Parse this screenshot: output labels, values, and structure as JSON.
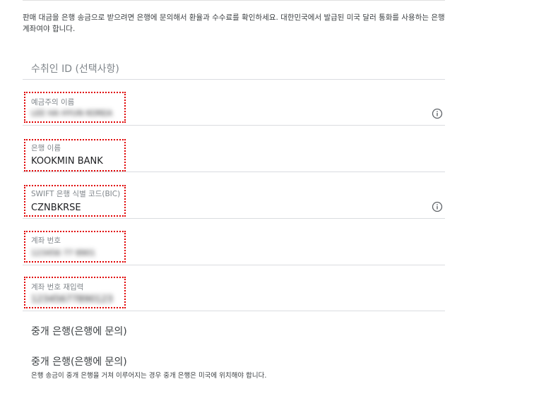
{
  "intro": {
    "text": "판매 대금을 은행 송금으로 받으려면 은행에 문의해서 환율과 수수료를 확인하세요. 대한민국에서 발급된 미국 달러 통화를 사용하는 은행 계좌여야 합니다."
  },
  "recipient_id": {
    "placeholder": "수취인 ID (선택사항)"
  },
  "account_holder": {
    "label": "예금주의 이름",
    "value": "LEE HA HYUN KOREA"
  },
  "bank_name": {
    "label": "은행 이름",
    "value": "KOOKMIN BANK"
  },
  "swift_code": {
    "label": "SWIFT 은행 식별 코드(BIC)",
    "value": "CZNBKRSE"
  },
  "account_number": {
    "label": "계좌 번호",
    "value": "123456 77 8901"
  },
  "account_number_confirm": {
    "label": "계좌 번호 재입력",
    "value": "12345677890123"
  },
  "intermediary": {
    "button_label": "중개 은행(은행에 문의)",
    "title": "중개 은행(은행에 문의)",
    "description": "은행 송금이 중개 은행을 거쳐 이루어지는 경우 중개 은행은 미국에 위치해야 합니다."
  },
  "colors": {
    "highlight": "#e00000",
    "divider": "#dadce0",
    "label": "#80868b"
  }
}
